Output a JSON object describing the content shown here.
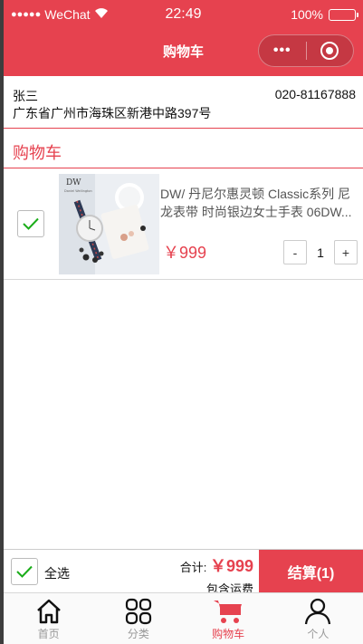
{
  "status_bar": {
    "carrier": "WeChat",
    "time": "22:49",
    "battery": "100%"
  },
  "nav": {
    "title": "购物车",
    "more_label": "•••"
  },
  "address": {
    "name": "张三",
    "phone": "020-81167888",
    "detail": "广东省广州市海珠区新港中路397号"
  },
  "section_title": "购物车",
  "cart_items": [
    {
      "title": "DW/ 丹尼尔惠灵顿 Classic系列 尼龙表带 时尚银边女士手表 06DW...",
      "price": "￥999",
      "quantity": "1",
      "checked": true
    }
  ],
  "stepper": {
    "minus": "-",
    "plus": "+"
  },
  "bottom_bar": {
    "select_all": "全选",
    "total_label": "合计:",
    "total_amount": "￥999",
    "shipping_note": "包含运费",
    "checkout": "结算(1)"
  },
  "tabs": [
    {
      "label": "首页",
      "icon": "home-icon"
    },
    {
      "label": "分类",
      "icon": "category-icon"
    },
    {
      "label": "购物车",
      "icon": "cart-icon",
      "active": true
    },
    {
      "label": "个人",
      "icon": "user-icon"
    }
  ],
  "colors": {
    "accent": "#e6424f",
    "check_green": "#1aad19"
  }
}
